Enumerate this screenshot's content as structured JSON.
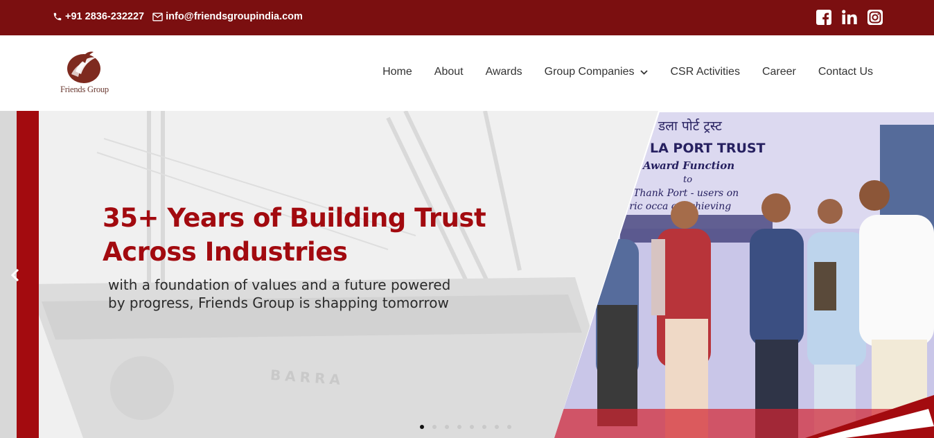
{
  "topbar": {
    "phone": "+91 2836-232227",
    "email": "info@friendsgroupindia.com",
    "social": [
      "facebook-icon",
      "linkedin-icon",
      "instagram-icon"
    ]
  },
  "header": {
    "logo_text": "Friends Group",
    "nav": [
      {
        "label": "Home"
      },
      {
        "label": "About"
      },
      {
        "label": "Awards"
      },
      {
        "label": "Group Companies",
        "has_dropdown": true
      },
      {
        "label": "CSR Activities"
      },
      {
        "label": "Career"
      },
      {
        "label": "Contact Us"
      }
    ]
  },
  "hero": {
    "title_line1": "35+ Years of Building Trust",
    "title_line2": "Across Industries",
    "subtitle_line1": "with a foundation of values and a future powered",
    "subtitle_line2": "by progress, Friends Group is shapping tomorrow",
    "banner_text_1": "डला पोर्ट ट्रस्ट",
    "banner_text_2": "LA PORT TRUST",
    "banner_text_3": "Award Function",
    "banner_text_4": "to",
    "banner_text_5": "Thank Port - users on",
    "banner_text_6": "oric occa    of achieving",
    "ship_name": "BARRA",
    "slides": 8,
    "active_slide": 1
  },
  "colors": {
    "brand_dark": "#7b0f10",
    "brand_red": "#a20a0f"
  }
}
